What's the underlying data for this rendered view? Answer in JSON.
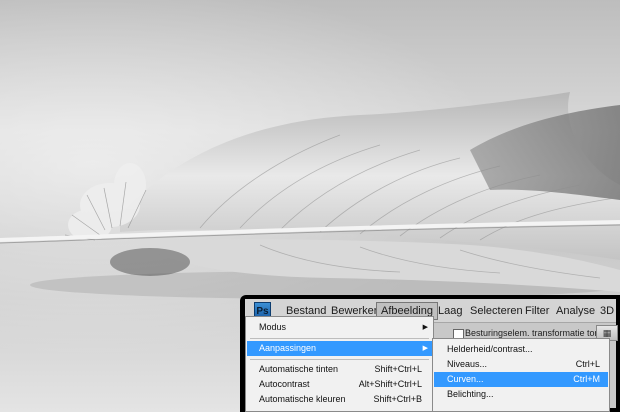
{
  "menubar": {
    "app_icon_text": "Ps",
    "items": [
      {
        "label": "Bestand"
      },
      {
        "label": "Bewerken"
      },
      {
        "label": "Afbeelding"
      },
      {
        "label": "Laag"
      },
      {
        "label": "Selecteren"
      },
      {
        "label": "Filter"
      },
      {
        "label": "Analyse"
      },
      {
        "label": "3D"
      }
    ],
    "active_item": "Afbeelding"
  },
  "options_bar": {
    "checkbox_label": "Besturingselem. transformatie tonen",
    "checkbox_checked": false
  },
  "image_menu": {
    "items": [
      {
        "label": "Modus",
        "shortcut": "",
        "submenu": true
      },
      {
        "label": "Aanpassingen",
        "shortcut": "",
        "submenu": true,
        "highlighted": true
      },
      {
        "label": "Automatische tinten",
        "shortcut": "Shift+Ctrl+L"
      },
      {
        "label": "Autocontrast",
        "shortcut": "Alt+Shift+Ctrl+L"
      },
      {
        "label": "Automatische kleuren",
        "shortcut": "Shift+Ctrl+B"
      }
    ]
  },
  "adjustments_submenu": {
    "items": [
      {
        "label": "Helderheid/contrast...",
        "shortcut": ""
      },
      {
        "label": "Niveaus...",
        "shortcut": "Ctrl+L"
      },
      {
        "label": "Curven...",
        "shortcut": "Ctrl+M",
        "highlighted": true
      },
      {
        "label": "Belichting...",
        "shortcut": ""
      }
    ]
  },
  "colors": {
    "highlight": "#3399ff",
    "menubar_bg": "#d4d4d4",
    "menu_bg": "#f1f1f1",
    "ps_icon": "#2b7ac2"
  }
}
